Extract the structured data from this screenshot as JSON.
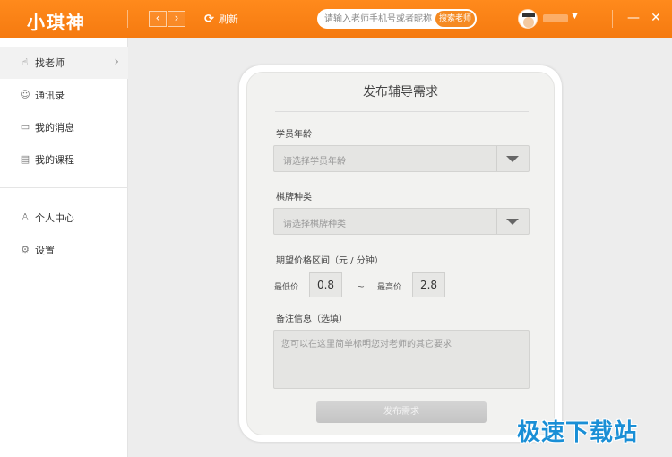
{
  "app": {
    "logo": "小琪神",
    "refresh_label": "刷新",
    "search_placeholder": "请输入老师手机号或者昵称",
    "search_button": "搜索老师",
    "nav_back": "‹",
    "nav_forward": "›",
    "minimize": "—",
    "close": "✕"
  },
  "sidebar": {
    "items": [
      {
        "label": "找老师",
        "icon": "hand-icon"
      },
      {
        "label": "通讯录",
        "icon": "contacts-icon"
      },
      {
        "label": "我的消息",
        "icon": "message-icon"
      },
      {
        "label": "我的课程",
        "icon": "course-icon"
      },
      {
        "label": "个人中心",
        "icon": "user-icon"
      },
      {
        "label": "设置",
        "icon": "gear-icon"
      }
    ]
  },
  "form": {
    "title": "发布辅导需求",
    "age_label": "学员年龄",
    "age_placeholder": "请选择学员年龄",
    "type_label": "棋牌种类",
    "type_placeholder": "请选择棋牌种类",
    "price_label": "期望价格区间（元 / 分钟）",
    "min_label": "最低价",
    "min_value": "0.8",
    "tilde": "~",
    "max_label": "最高价",
    "max_value": "2.8",
    "notes_label": "备注信息（选填）",
    "notes_placeholder": "您可以在这里简单标明您对老师的其它要求",
    "submit_label": "发布需求"
  },
  "watermark": "极速下载站",
  "colors": {
    "brand": "#f57a10",
    "accent": "#f58a22"
  }
}
